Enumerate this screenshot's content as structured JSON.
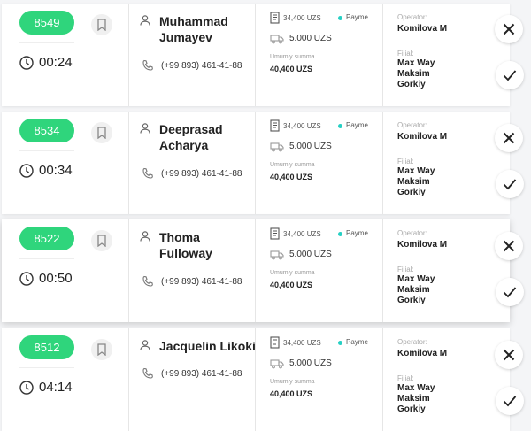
{
  "orders": [
    {
      "id": "8549",
      "timer": "00:24",
      "customer": "Muhammad Jumayev",
      "phone": "(+99 893) 461-41-88",
      "amount": "34,400 UZS",
      "payment": "Payme",
      "delivery": "5.000 UZS",
      "total_label": "Umumiy summa",
      "total": "40,400 UZS",
      "operator_label": "Operator:",
      "operator": "Komilova M",
      "filial_label": "Filial:",
      "filial": "Max Way Maksim Gorkiy"
    },
    {
      "id": "8534",
      "timer": "00:34",
      "customer": "Deeprasad Acharya",
      "phone": "(+99 893) 461-41-88",
      "amount": "34,400 UZS",
      "payment": "Payme",
      "delivery": "5.000 UZS",
      "total_label": "Umumiy summa",
      "total": "40,400 UZS",
      "operator_label": "Operator:",
      "operator": "Komilova M",
      "filial_label": "Filial:",
      "filial": "Max Way Maksim Gorkiy"
    },
    {
      "id": "8522",
      "timer": "00:50",
      "customer": "Thoma Fulloway",
      "phone": "(+99 893) 461-41-88",
      "amount": "34,400 UZS",
      "payment": "Payme",
      "delivery": "5.000 UZS",
      "total_label": "Umumiy summa",
      "total": "40,400 UZS",
      "operator_label": "Operator:",
      "operator": "Komilova M",
      "filial_label": "Filial:",
      "filial": "Max Way Maksim Gorkiy"
    },
    {
      "id": "8512",
      "timer": "04:14",
      "customer": "Jacquelin Likoki",
      "phone": "(+99 893) 461-41-88",
      "amount": "34,400 UZS",
      "payment": "Payme",
      "delivery": "5.000 UZS",
      "total_label": "Umumiy summa",
      "total": "40,400 UZS",
      "operator_label": "Operator:",
      "operator": "Komilova M",
      "filial_label": "Filial:",
      "filial": "Max Way Maksim Gorkiy"
    }
  ],
  "colors": {
    "badge": "#2fd57c",
    "payme_dot": "#26d0c4"
  },
  "icons": [
    "bookmark-icon",
    "clock-icon",
    "person-icon",
    "phone-icon",
    "receipt-icon",
    "truck-icon",
    "close-icon",
    "check-icon"
  ]
}
